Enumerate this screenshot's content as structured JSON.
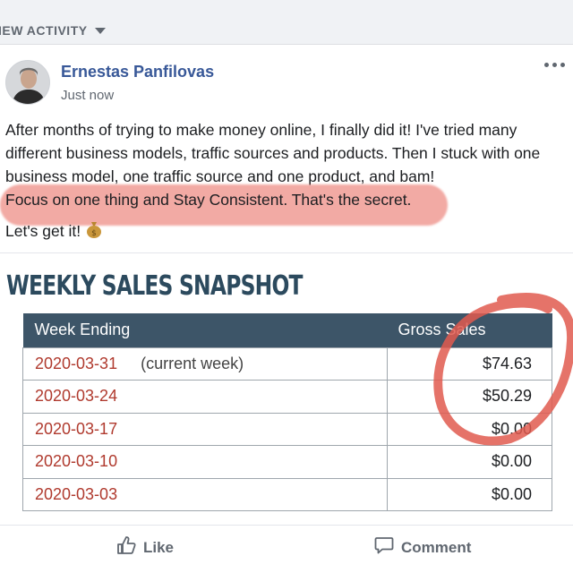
{
  "header": {
    "view_activity_label": "IEW ACTIVITY"
  },
  "post": {
    "author": "Ernestas Panfilovas",
    "timestamp": "Just now",
    "paragraph": "After months of trying to make money online, I finally did it! I've tried many different business models, traffic sources and products. Then I stuck with one business model, one traffic source and one product, and bam!",
    "highlight_line": "Focus on one thing and Stay Consistent. That's the secret.",
    "closing_line": "Let's get it!"
  },
  "snapshot": {
    "title": "WEEKLY SALES SNAPSHOT",
    "columns": [
      "Week Ending",
      "Gross Sales"
    ],
    "rows": [
      {
        "date": "2020-03-31",
        "note": "(current week)",
        "amount": "$74.63"
      },
      {
        "date": "2020-03-24",
        "note": "",
        "amount": "$50.29"
      },
      {
        "date": "2020-03-17",
        "note": "",
        "amount": "$0.00"
      },
      {
        "date": "2020-03-10",
        "note": "",
        "amount": "$0.00"
      },
      {
        "date": "2020-03-03",
        "note": "",
        "amount": "$0.00"
      }
    ]
  },
  "actions": {
    "like_label": "Like",
    "comment_label": "Comment"
  },
  "colors": {
    "link_blue": "#385898",
    "table_header": "#3d5568",
    "date_red": "#b03a2e",
    "marker_red": "#e05a4f"
  },
  "icons": [
    "caret-down-icon",
    "more-options-icon",
    "money-bag-icon",
    "thumbs-up-icon",
    "comment-icon"
  ]
}
